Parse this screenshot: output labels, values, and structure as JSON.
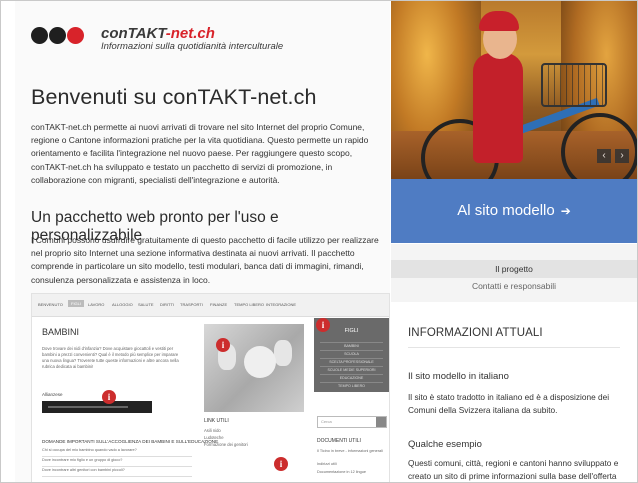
{
  "logo": {
    "brand_main": "conTAKT",
    "brand_suffix": "-net.ch",
    "tagline": "Informazioni sulla quotidianità interculturale",
    "colors": {
      "dot_dark": "#1f1f1f",
      "dot_red": "#d8232a",
      "dot_red2": "#e14a4f"
    }
  },
  "main": {
    "title": "Benvenuti su conTAKT-net.ch",
    "intro": "conTAKT-net.ch permette ai nuovi arrivati di trovare nel sito Internet del proprio Comune, regione o Cantone informazioni pratiche per la vita quotidiana. Questo permette un rapido orientamento e facilita l'integrazione nel nuovo paese. Per raggiungere questo scopo, conTAKT-net.ch ha sviluppato e testato un pacchetto di servizi di promozione, in collaborazione con migranti, specialisti dell'integrazione e autorità.",
    "subtitle": "Un pacchetto web pronto per l'uso e personalizzabile",
    "package_text": "I Comuni possono usufruire gratuitamente di questo pacchetto di facile utilizzo per realizzare nel proprio sito Internet una sezione informativa destinata ai nuovi arrivati. Il pacchetto comprende in particolare un sito modello, testi modulari, banca dati di immagini, rimandi, consulenza personalizzata e assistenza in loco."
  },
  "preview": {
    "nav": [
      "BENVENUTO",
      "FIGLI",
      "LAVORO",
      "ALLOGGIO",
      "SALUTE",
      "DIRITTI",
      "TRASPORTI",
      "FINANZE",
      "TEMPO LIBERO",
      "INTEGRAZIONE"
    ],
    "heading": "BAMBINI",
    "text": "Dove trovare dei nidi d'infanzia? Dove acquistare giocattoli e vestiti per bambini a prezzi convenienti? Qual è il metodo più semplice per imparare una nuova lingua? Troverete tutte queste informazioni e altre ancora nella rubrica dedicata ai bambini!",
    "allianz": "Allianzese",
    "links_head": "LINK UTILI",
    "links": [
      "Asili nido",
      "Ludoteche",
      "Formazione dei genitori"
    ],
    "side_head": "FIGLI",
    "side_items": [
      "BAMBINI",
      "SCUOLA",
      "SCELTA PROFESSIONALE",
      "SCUOLE MEDIE SUPERIORI",
      "EDUCAZIONE",
      "TEMPO LIBERO"
    ],
    "search_placeholder": "Cerca",
    "docs_head": "DOCUMENTI UTILI",
    "docs": [
      "Il Ticino in breve - informazioni generali",
      "Indirizzi utili",
      "Documentazione in 12 lingue"
    ],
    "questions_head": "DOMANDE IMPORTANTI SULL'ACCOGLIENZA DEI BAMBINI E SULL'EDUCAZIONE",
    "questions": [
      "Chi si occupa del mio bambino quando vado a lavorare?",
      "Dove incontrare mio figlio e un gruppo di gioco?",
      "Dove incontrare altri genitori con bambini piccoli?"
    ],
    "badge_symbol": "i"
  },
  "right": {
    "hero_prev": "‹",
    "hero_next": "›",
    "cta_label": "Al sito modello",
    "cta_icon": "sign-in-icon",
    "cta_icon_glyph": "➔",
    "menu": [
      "Il progetto",
      "Contatti e responsabili"
    ],
    "info_head": "INFORMAZIONI ATTUALI",
    "news": [
      {
        "title": "Il sito modello in italiano",
        "text": "Il sito è stato tradotto in italiano ed è a disposizione dei Comuni della Svizzera italiana da subito."
      },
      {
        "title": "Qualche esempio",
        "text": "Questi comuni, città, regioni e cantoni hanno sviluppato e creato un sito di prime informazioni sulla base dell'offerta"
      }
    ],
    "colors": {
      "cta_bg": "#4f7cc3"
    }
  }
}
